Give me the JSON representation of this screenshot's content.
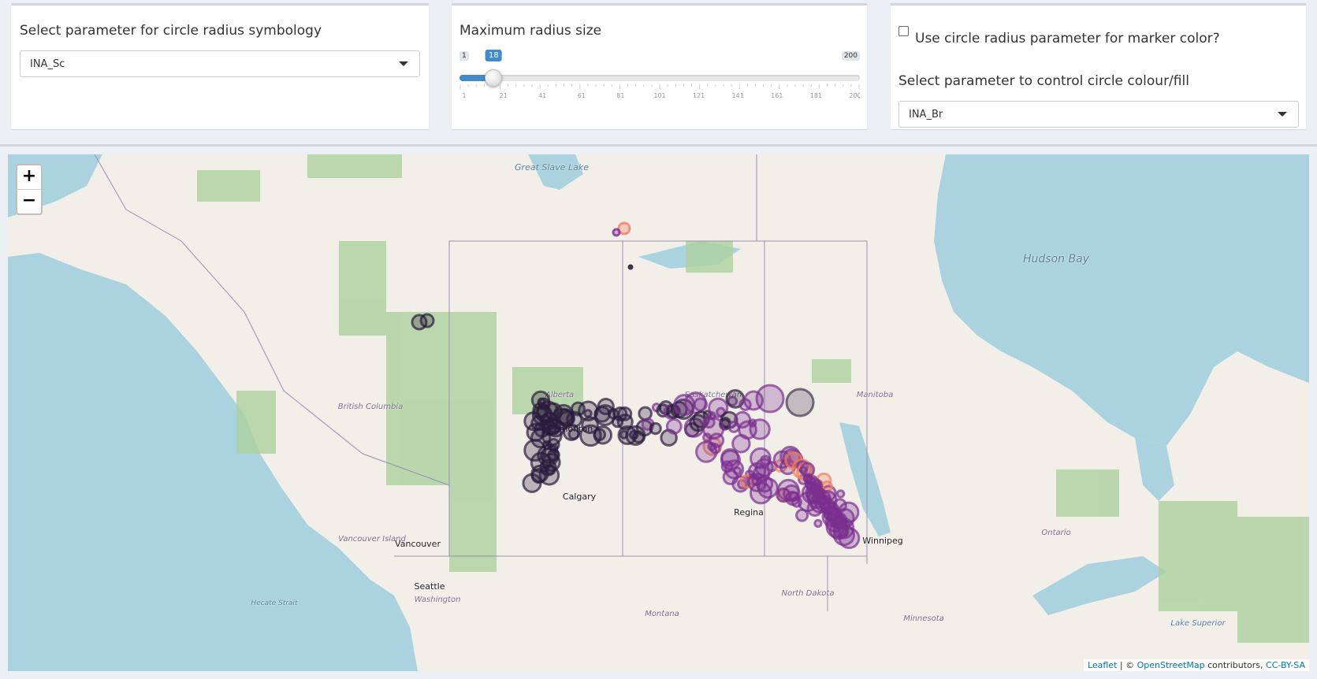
{
  "panels": {
    "radius_param": {
      "label": "Select parameter for circle radius symbology",
      "selected": "INA_Sc"
    },
    "max_radius": {
      "label": "Maximum radius size",
      "min": 1,
      "max": 200,
      "value": 18,
      "min_label": "1",
      "max_label": "200",
      "value_label": "18",
      "tick_labels": [
        "1",
        "21",
        "41",
        "61",
        "81",
        "101",
        "121",
        "141",
        "161",
        "181",
        "200"
      ]
    },
    "color": {
      "checkbox_label": "Use circle radius parameter for marker color?",
      "checkbox_checked": false,
      "select_label": "Select parameter to control circle colour/fill",
      "selected": "INA_Br"
    }
  },
  "map": {
    "zoom_in": "+",
    "zoom_out": "−",
    "places": [
      {
        "name": "Great Slave Lake",
        "kind": "water"
      },
      {
        "name": "Hudson Bay",
        "kind": "water"
      },
      {
        "name": "Hecate Strait",
        "kind": "water"
      },
      {
        "name": "Lake Superior",
        "kind": "water"
      },
      {
        "name": "British Columbia",
        "kind": "region"
      },
      {
        "name": "Alberta",
        "kind": "region"
      },
      {
        "name": "Saskatchewan",
        "kind": "region"
      },
      {
        "name": "Manitoba",
        "kind": "region"
      },
      {
        "name": "Ontario",
        "kind": "region"
      },
      {
        "name": "Washington",
        "kind": "region"
      },
      {
        "name": "Montana",
        "kind": "region"
      },
      {
        "name": "North Dakota",
        "kind": "region"
      },
      {
        "name": "Minnesota",
        "kind": "region"
      },
      {
        "name": "Vancouver Island",
        "kind": "region"
      },
      {
        "name": "Edmonton",
        "kind": "city"
      },
      {
        "name": "Calgary",
        "kind": "city"
      },
      {
        "name": "Regina",
        "kind": "city"
      },
      {
        "name": "Winnipeg",
        "kind": "city"
      },
      {
        "name": "Vancouver",
        "kind": "city"
      },
      {
        "name": "Seattle",
        "kind": "city"
      }
    ],
    "attribution": {
      "leaflet": "Leaflet",
      "sep": " | © ",
      "osm": "OpenStreetMap",
      "contrib": " contributors, ",
      "license": "CC-BY-SA"
    },
    "colors": {
      "water": "#aad3df",
      "land": "#f2efe9",
      "forest": "#add19e",
      "dark": "#2b1b3d",
      "purple": "#7a2f8f",
      "orange": "#f08060"
    }
  }
}
